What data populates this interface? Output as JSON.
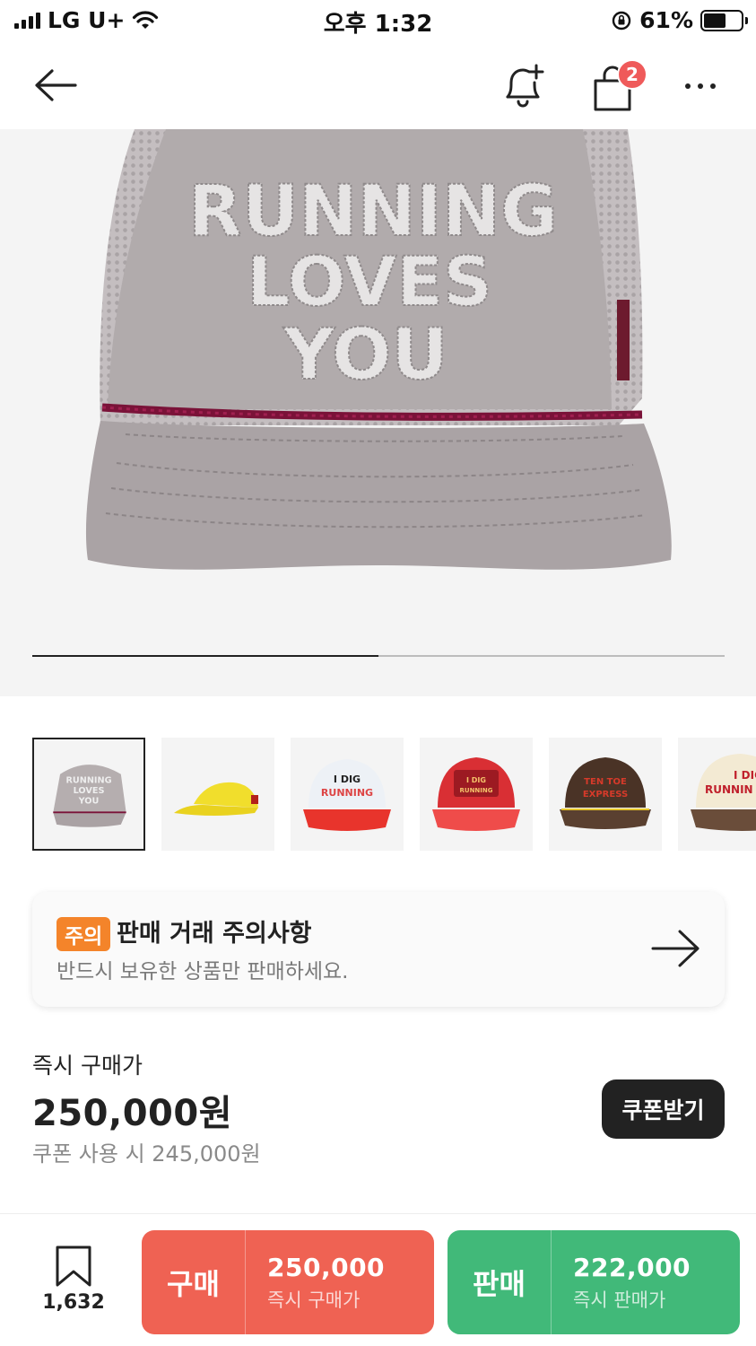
{
  "status_bar": {
    "carrier": "LG U+",
    "time": "오후 1:32",
    "battery": "61%",
    "battery_level": 0.61
  },
  "nav": {
    "cart_badge": "2"
  },
  "hero": {
    "cap_text_lines": [
      "RUNNING",
      "LOVES",
      "YOU"
    ],
    "carousel_progress": 0.5
  },
  "thumbnails": [
    {
      "name": "thumb-running-loves-you",
      "text": "RUNNING LOVES YOU",
      "selected": true
    },
    {
      "name": "thumb-yellow-cap",
      "text": "",
      "selected": false
    },
    {
      "name": "thumb-i-dig-running-red",
      "text": "I DIG RUNNING",
      "selected": false
    },
    {
      "name": "thumb-i-dig-running-mesh",
      "text": "I DIG RUNNING",
      "selected": false
    },
    {
      "name": "thumb-ten-toe-express",
      "text": "TEN TOE EXPRESS",
      "selected": false
    },
    {
      "name": "thumb-i-dig-running-brown",
      "text": "I DIG RUNNIN",
      "selected": false
    }
  ],
  "notice": {
    "tag": "주의",
    "title": "판매 거래 주의사항",
    "subtitle": "반드시 보유한 상품만 판매하세요."
  },
  "price": {
    "label": "즉시 구매가",
    "value": "250,000원",
    "coupon_text": "쿠폰 사용 시 245,000원",
    "coupon_button": "쿠폰받기"
  },
  "bottom_bar": {
    "bookmark_count": "1,632",
    "buy": {
      "label": "구매",
      "price": "250,000",
      "sub": "즉시 구매가"
    },
    "sell": {
      "label": "판매",
      "price": "222,000",
      "sub": "즉시 판매가"
    }
  },
  "colors": {
    "buy": "#ef6253",
    "sell": "#41b979",
    "notice_tag": "#f4842a",
    "badge": "#ef5a5a"
  }
}
